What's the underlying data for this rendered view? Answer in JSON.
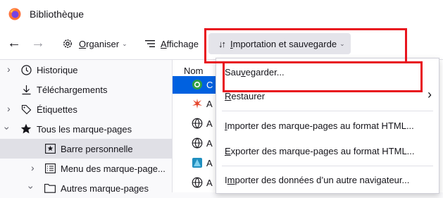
{
  "window": {
    "title": "Bibliothèque",
    "icon": "firefox-logo-icon"
  },
  "toolbar": {
    "back_icon": "back-arrow-icon",
    "forward_icon": "forward-arrow-icon",
    "organize_u": "O",
    "organize_rest": "rganiser",
    "view_u": "A",
    "view_rest": "ffichage",
    "import_u": "I",
    "import_rest": "mportation et sauvegarde"
  },
  "sidebar": {
    "items": [
      {
        "label": "Historique",
        "icon": "clock-icon"
      },
      {
        "label": "Téléchargements",
        "icon": "download-icon"
      },
      {
        "label": "Étiquettes",
        "icon": "tag-icon"
      },
      {
        "label": "Tous les marque-pages",
        "icon": "star-icon"
      },
      {
        "label": "Barre personnelle",
        "icon": "bookmark-toolbar-icon"
      },
      {
        "label": "Menu des marque-page...",
        "icon": "menu-list-icon"
      },
      {
        "label": "Autres marque-pages",
        "icon": "folder-icon"
      }
    ]
  },
  "list": {
    "column_name": "Nom",
    "rows": [
      "C",
      "A",
      "A",
      "A",
      "A",
      "A"
    ]
  },
  "menu": {
    "save_pre": "Sau",
    "save_u": "v",
    "save_post": "egarder...",
    "restore_u": "R",
    "restore_rest": "estaurer",
    "import_html_u": "I",
    "import_html_rest": "mporter des marque-pages au format HTML...",
    "export_html_u": "E",
    "export_html_rest": "xporter des marque-pages au format HTML...",
    "import_other_pre": "I",
    "import_other_u": "m",
    "import_other_post": "porter des données d’un autre navigateur..."
  },
  "colors": {
    "highlight": "#e8141e",
    "selection": "#0061e0"
  }
}
